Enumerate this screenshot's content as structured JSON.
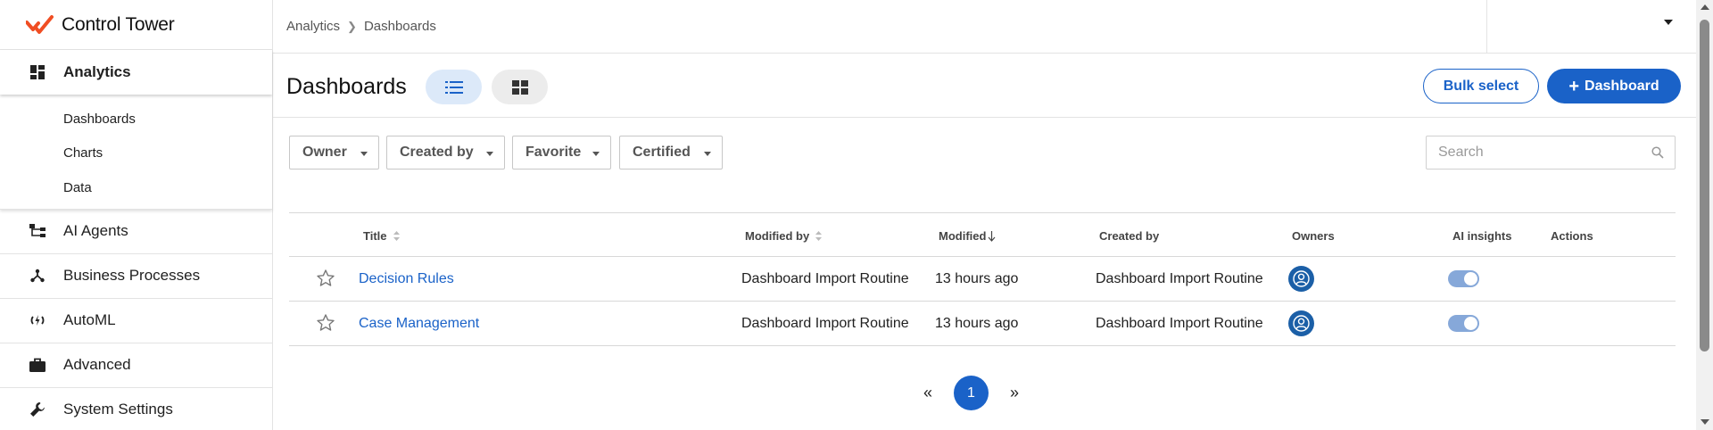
{
  "app": {
    "name": "Control Tower",
    "logo_icon": "control-tower-logo",
    "accent": "#1a62c8",
    "logo_color": "#f04e23"
  },
  "sidebar": {
    "items": [
      {
        "label": "Analytics",
        "icon": "dashboard-grid-icon",
        "active": true,
        "children": [
          {
            "label": "Dashboards"
          },
          {
            "label": "Charts"
          },
          {
            "label": "Data"
          }
        ]
      },
      {
        "label": "AI Agents",
        "icon": "hierarchy-icon"
      },
      {
        "label": "Business Processes",
        "icon": "branch-icon"
      },
      {
        "label": "AutoML",
        "icon": "automl-icon"
      },
      {
        "label": "Advanced",
        "icon": "briefcase-icon"
      },
      {
        "label": "System Settings",
        "icon": "wrench-icon"
      }
    ]
  },
  "breadcrumb": [
    "Analytics",
    "Dashboards"
  ],
  "page": {
    "title": "Dashboards",
    "view_modes": [
      {
        "name": "list-view",
        "icon": "list-icon",
        "selected": true
      },
      {
        "name": "grid-view",
        "icon": "grid-icon",
        "selected": false
      }
    ],
    "bulk_select_label": "Bulk select",
    "add_label": "Dashboard"
  },
  "filters": [
    "Owner",
    "Created by",
    "Favorite",
    "Certified"
  ],
  "search": {
    "placeholder": "Search",
    "value": ""
  },
  "table": {
    "columns": [
      "Title",
      "Modified by",
      "Modified",
      "Created by",
      "Owners",
      "AI insights",
      "Actions"
    ],
    "sorted_by": "Modified",
    "sort_direction": "desc",
    "rows": [
      {
        "title": "Decision Rules",
        "modified_by": "Dashboard Import Routine",
        "modified": "13 hours ago",
        "created_by": "Dashboard Import Routine",
        "owner_icon": "user-avatar-icon",
        "ai_insights": true,
        "favorite": false
      },
      {
        "title": "Case Management",
        "modified_by": "Dashboard Import Routine",
        "modified": "13 hours ago",
        "created_by": "Dashboard Import Routine",
        "owner_icon": "user-avatar-icon",
        "ai_insights": true,
        "favorite": false
      }
    ]
  },
  "pagination": {
    "prev": "«",
    "current": "1",
    "next": "»"
  }
}
